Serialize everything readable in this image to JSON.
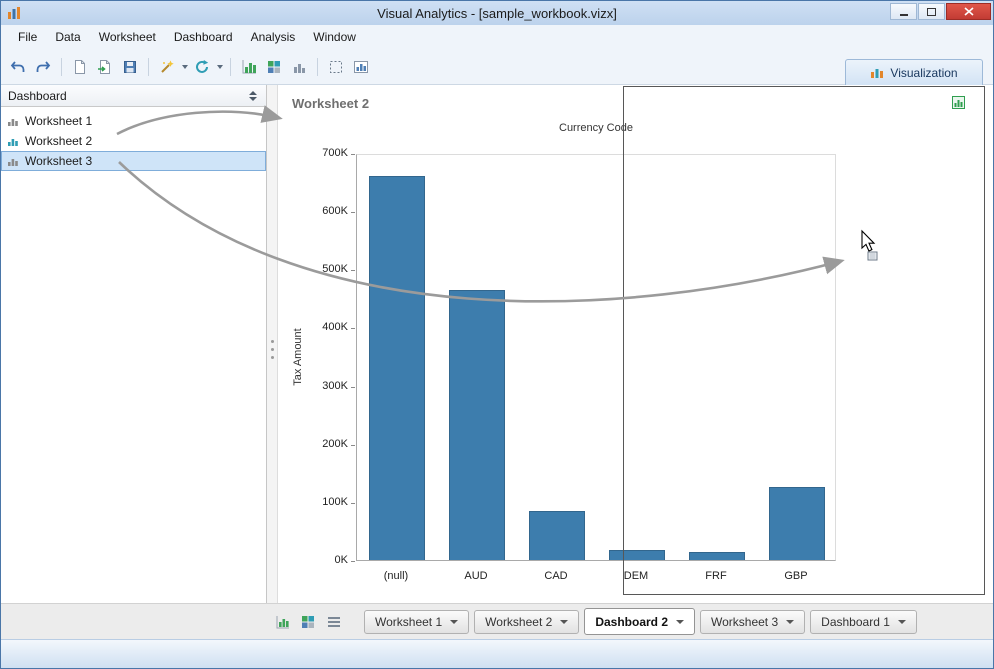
{
  "window": {
    "title": "Visual Analytics - [sample_workbook.vizx]",
    "controls": [
      "minimize-icon",
      "maximize-icon",
      "close-icon"
    ]
  },
  "menu": {
    "items": [
      "File",
      "Data",
      "Worksheet",
      "Dashboard",
      "Analysis",
      "Window"
    ]
  },
  "toolbar": {
    "visualization_tab": "Visualization",
    "icons": [
      "undo-icon",
      "redo-icon",
      "new-document-icon",
      "open-icon",
      "save-icon",
      "magic-wand-icon",
      "refresh-icon",
      "insert-graph-icon",
      "insert-table-icon",
      "insert-crosstab-icon",
      "selection-icon",
      "insert-dashboard-icon"
    ]
  },
  "sidebar": {
    "header": "Dashboard",
    "items": [
      {
        "label": "Worksheet 1",
        "selected": false,
        "icon_color": "#8a8a8a"
      },
      {
        "label": "Worksheet 2",
        "selected": false,
        "icon_color": "#2f9db4"
      },
      {
        "label": "Worksheet 3",
        "selected": true,
        "icon_color": "#8a8a8a"
      }
    ]
  },
  "chart_data": {
    "type": "bar",
    "panel_title": "Worksheet 2",
    "column_header": "Currency Code",
    "ylabel": "Tax Amount",
    "categories": [
      "(null)",
      "AUD",
      "CAD",
      "DEM",
      "FRF",
      "GBP"
    ],
    "values": [
      660000,
      465000,
      85000,
      18000,
      14000,
      125000
    ],
    "yticks": [
      "0K",
      "100K",
      "200K",
      "300K",
      "400K",
      "500K",
      "600K",
      "700K"
    ],
    "ylim": [
      0,
      700000
    ],
    "bar_color": "#3d7dad",
    "grid": false,
    "legend": "none"
  },
  "bottom_tabs": {
    "view_icons": [
      "graph-view-icon",
      "grid-view-icon",
      "list-view-icon"
    ],
    "tabs": [
      {
        "label": "Worksheet 1",
        "active": false
      },
      {
        "label": "Worksheet 2",
        "active": false
      },
      {
        "label": "Dashboard 2",
        "active": true
      },
      {
        "label": "Worksheet 3",
        "active": false
      },
      {
        "label": "Dashboard 1",
        "active": false
      }
    ]
  },
  "overlay": {
    "drag_rectangle_visible": true,
    "cursor": "arrow-drag-cursor"
  },
  "colors": {
    "bar": "#3d7dad",
    "selection_bg": "#cfe4f8",
    "selection_border": "#7fadda",
    "window_border": "#4a76a8",
    "close_button": "#c23b34",
    "arrow_gray": "#9b9b9b"
  }
}
